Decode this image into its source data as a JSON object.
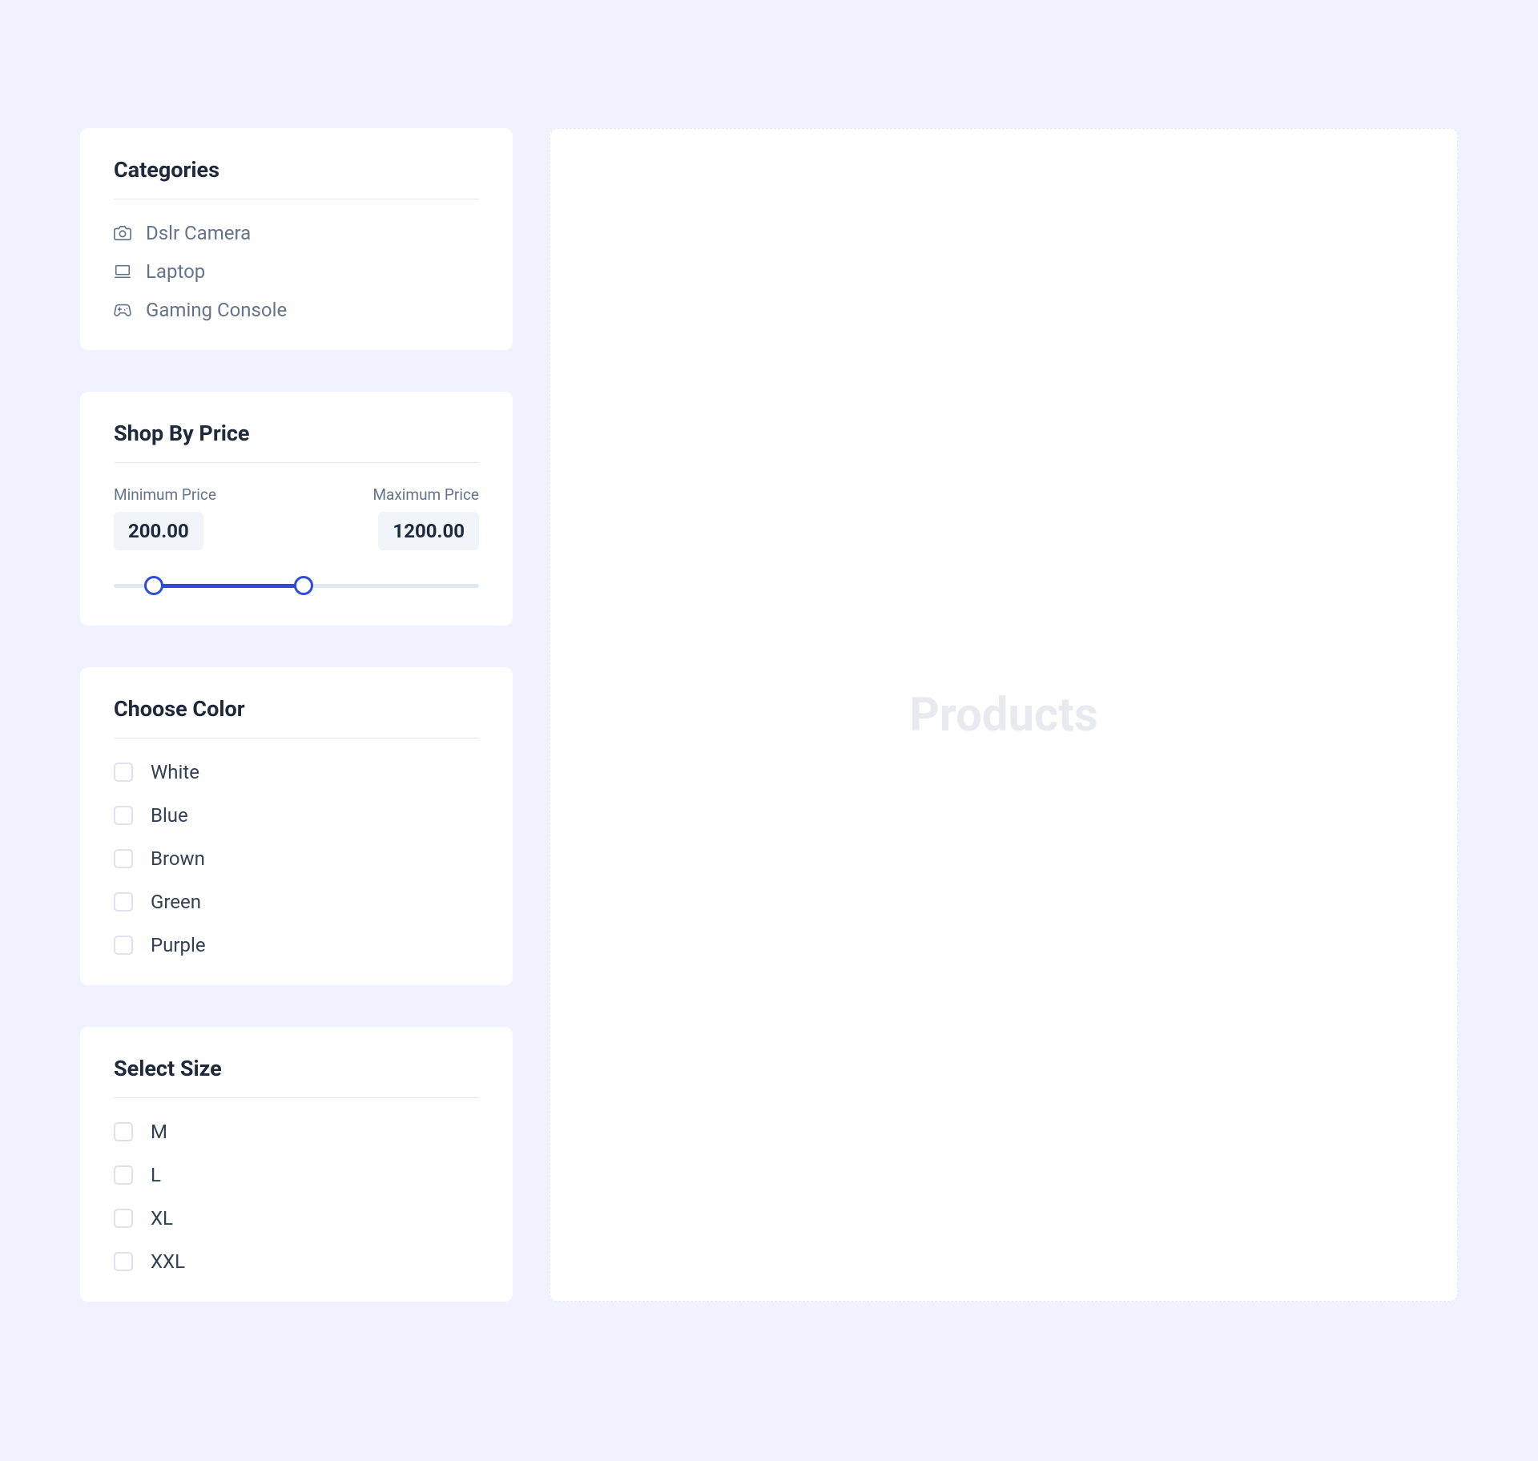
{
  "sidebar": {
    "categories": {
      "title": "Categories",
      "items": [
        {
          "label": "Dslr Camera",
          "icon": "camera"
        },
        {
          "label": "Laptop",
          "icon": "laptop"
        },
        {
          "label": "Gaming Console",
          "icon": "console"
        }
      ]
    },
    "price": {
      "title": "Shop By Price",
      "min_label": "Minimum Price",
      "max_label": "Maximum Price",
      "min_value": "200.00",
      "max_value": "1200.00",
      "range_min": 0,
      "range_max": 2000,
      "selected_min": 200,
      "selected_max": 1200
    },
    "color": {
      "title": "Choose Color",
      "options": [
        {
          "label": "White"
        },
        {
          "label": "Blue"
        },
        {
          "label": "Brown"
        },
        {
          "label": "Green"
        },
        {
          "label": "Purple"
        }
      ]
    },
    "size": {
      "title": "Select Size",
      "options": [
        {
          "label": "M"
        },
        {
          "label": "L"
        },
        {
          "label": "XL"
        },
        {
          "label": "XXL"
        }
      ]
    }
  },
  "main": {
    "placeholder": "Products"
  }
}
